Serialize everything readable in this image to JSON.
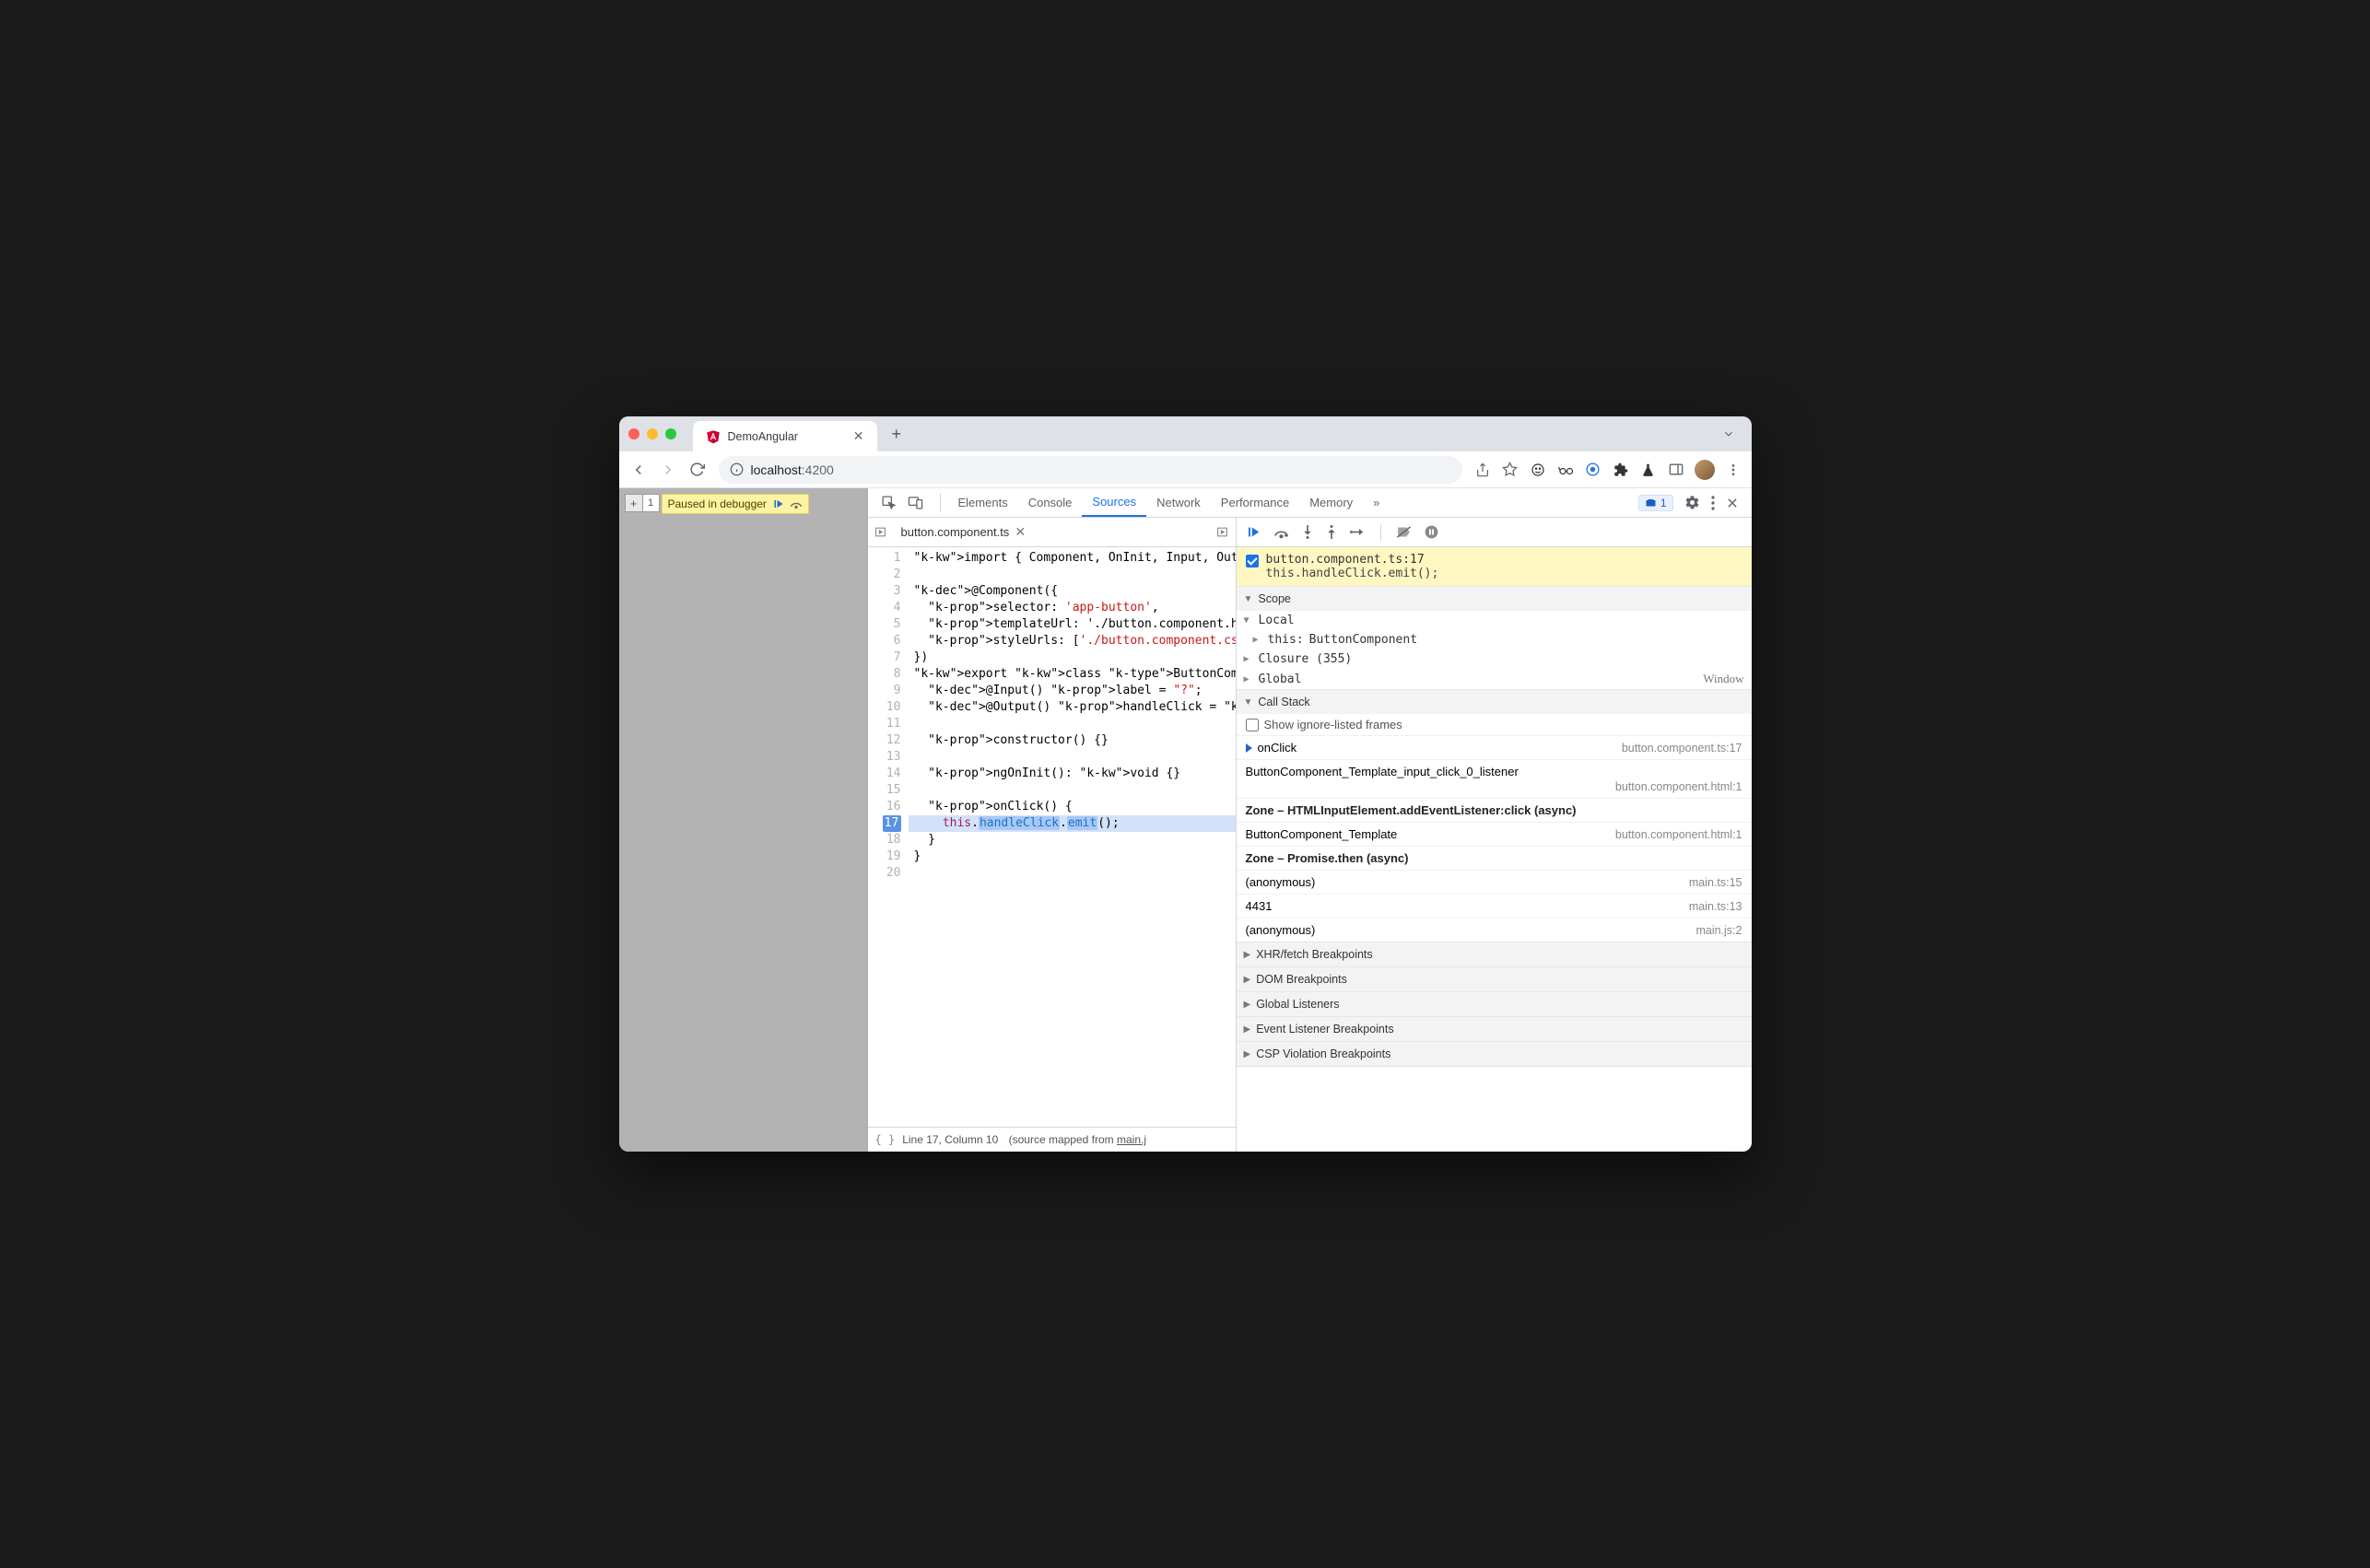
{
  "browser": {
    "tab_title": "DemoAngular",
    "url_host": "localhost",
    "url_port": ":4200",
    "paused_label": "Paused in debugger"
  },
  "devtools": {
    "tabs": [
      "Elements",
      "Console",
      "Sources",
      "Network",
      "Performance",
      "Memory"
    ],
    "active_tab": "Sources",
    "more": "»",
    "issues_count": "1"
  },
  "editor": {
    "filename": "button.component.ts",
    "status_line": "Line 17, Column 10",
    "status_mapped_prefix": "(source mapped from ",
    "status_mapped_link": "main.j",
    "lines": [
      {
        "n": 1,
        "raw": "import { Component, OnInit, Input, Outp"
      },
      {
        "n": 2,
        "raw": ""
      },
      {
        "n": 3,
        "raw": "@Component({"
      },
      {
        "n": 4,
        "raw": "  selector: 'app-button',"
      },
      {
        "n": 5,
        "raw": "  templateUrl: './button.component.html"
      },
      {
        "n": 6,
        "raw": "  styleUrls: ['./button.component.css']"
      },
      {
        "n": 7,
        "raw": "})"
      },
      {
        "n": 8,
        "raw": "export class ButtonComponent implements"
      },
      {
        "n": 9,
        "raw": "  @Input() label = \"?\";"
      },
      {
        "n": 10,
        "raw": "  @Output() handleClick = new EventEmit"
      },
      {
        "n": 11,
        "raw": ""
      },
      {
        "n": 12,
        "raw": "  constructor() {}"
      },
      {
        "n": 13,
        "raw": ""
      },
      {
        "n": 14,
        "raw": "  ngOnInit(): void {}"
      },
      {
        "n": 15,
        "raw": ""
      },
      {
        "n": 16,
        "raw": "  onClick() {"
      },
      {
        "n": 17,
        "raw": "    this.▷handleClick.▷emit();",
        "hl": true
      },
      {
        "n": 18,
        "raw": "  }"
      },
      {
        "n": 19,
        "raw": "}"
      },
      {
        "n": 20,
        "raw": ""
      }
    ]
  },
  "breakpoint_card": {
    "title": "button.component.ts:17",
    "code": "this.handleClick.emit();"
  },
  "scope": {
    "header": "Scope",
    "local_label": "Local",
    "rows": [
      {
        "k": "this:",
        "v": "ButtonComponent"
      },
      {
        "k": "Closure (355)",
        "v": ""
      },
      {
        "k": "Global",
        "v": "Window"
      }
    ]
  },
  "callstack": {
    "header": "Call Stack",
    "show_ignore": "Show ignore-listed frames",
    "frames": [
      {
        "name": "onClick",
        "loc": "button.component.ts:17",
        "current": true
      },
      {
        "name": "ButtonComponent_Template_input_click_0_listener",
        "loc": "button.component.html:1",
        "sub": true
      },
      {
        "name": "Zone – HTMLInputElement.addEventListener:click (async)",
        "async": true
      },
      {
        "name": "ButtonComponent_Template",
        "loc": "button.component.html:1"
      },
      {
        "name": "Zone – Promise.then (async)",
        "async": true
      },
      {
        "name": "(anonymous)",
        "loc": "main.ts:15"
      },
      {
        "name": "4431",
        "loc": "main.ts:13"
      },
      {
        "name": "(anonymous)",
        "loc": "main.js:2"
      }
    ]
  },
  "collapsed_sections": [
    "XHR/fetch Breakpoints",
    "DOM Breakpoints",
    "Global Listeners",
    "Event Listener Breakpoints",
    "CSP Violation Breakpoints"
  ]
}
